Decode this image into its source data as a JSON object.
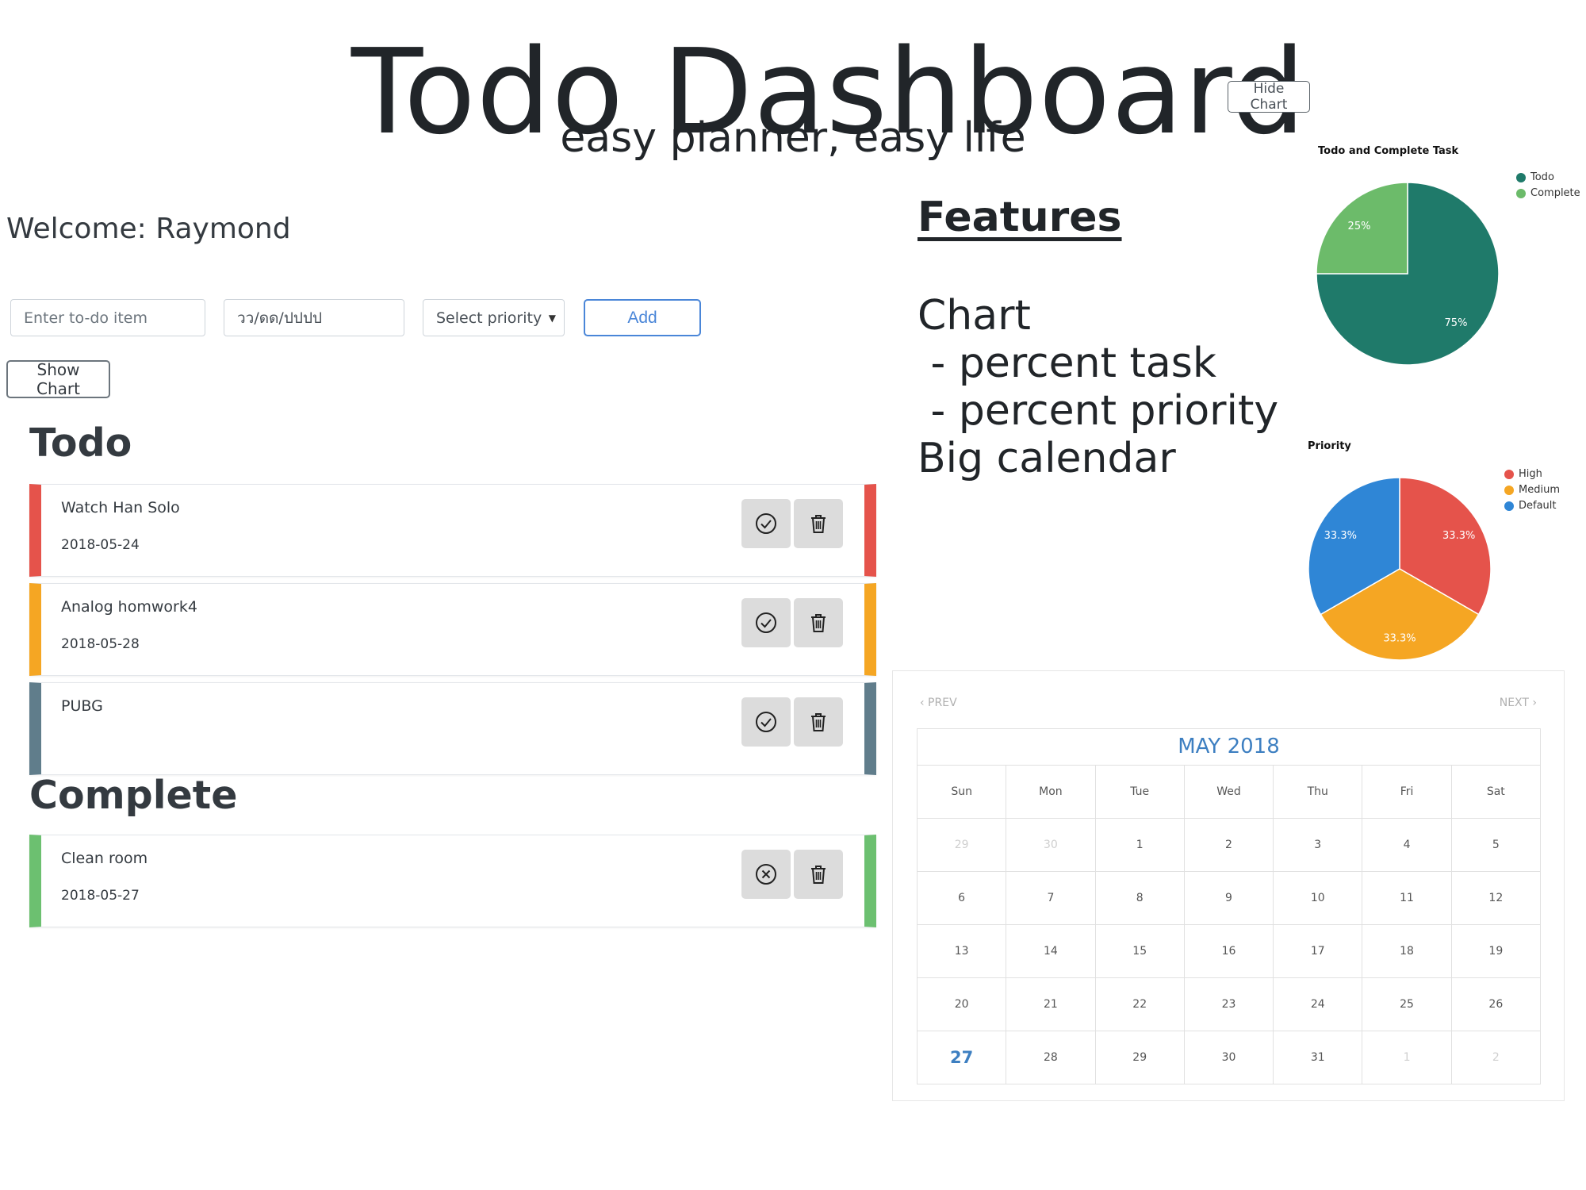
{
  "header": {
    "title": "Todo Dashboard",
    "subtitle": "easy planner, easy life",
    "hide_chart_label": "Hide Chart"
  },
  "welcome": "Welcome: Raymond",
  "form": {
    "todo_placeholder": "Enter to-do item",
    "date_placeholder": "วว/ดด/ปปปป",
    "priority_label": "Select priority",
    "add_label": "Add",
    "show_chart_label": "Show Chart"
  },
  "todo": {
    "title": "Todo",
    "items": [
      {
        "name": "Watch Han Solo",
        "date": "2018-05-24",
        "color": "#e5534b"
      },
      {
        "name": "Analog homwork4",
        "date": "2018-05-28",
        "color": "#f5a623"
      },
      {
        "name": "PUBG",
        "date": "",
        "color": "#607d8b"
      }
    ]
  },
  "complete": {
    "title": "Complete",
    "items": [
      {
        "name": "Clean room",
        "date": "2018-05-27",
        "color": "#6cc070"
      }
    ]
  },
  "features": {
    "title": "Features",
    "lines": [
      "Chart",
      " - percent task",
      " - percent priority",
      "Big calendar"
    ]
  },
  "charts": {
    "task": {
      "title": "Todo and Complete Task",
      "legend": [
        {
          "label": "Todo",
          "color": "#1f7a6a"
        },
        {
          "label": "Complete",
          "color": "#6cbb6a"
        }
      ],
      "slices": [
        {
          "label": "Todo",
          "percent": "75%",
          "value": 75,
          "color": "#1f7a6a"
        },
        {
          "label": "Complete",
          "percent": "25%",
          "value": 25,
          "color": "#6cbb6a"
        }
      ]
    },
    "priority": {
      "title": "Priority",
      "legend": [
        {
          "label": "High",
          "color": "#e5534b"
        },
        {
          "label": "Medium",
          "color": "#f5a623"
        },
        {
          "label": "Default",
          "color": "#2f86d6"
        }
      ],
      "slices": [
        {
          "label": "High",
          "percent": "33.3%",
          "value": 33.3,
          "color": "#e5534b"
        },
        {
          "label": "Medium",
          "percent": "33.3%",
          "value": 33.3,
          "color": "#f5a623"
        },
        {
          "label": "Default",
          "percent": "33.3%",
          "value": 33.3,
          "color": "#2f86d6"
        }
      ]
    }
  },
  "calendar": {
    "prev_label": "‹ PREV",
    "next_label": "NEXT ›",
    "month": "MAY 2018",
    "weekdays": [
      "Sun",
      "Mon",
      "Tue",
      "Wed",
      "Thu",
      "Fri",
      "Sat"
    ],
    "weeks": [
      [
        "29",
        "30",
        "1",
        "2",
        "3",
        "4",
        "5"
      ],
      [
        "6",
        "7",
        "8",
        "9",
        "10",
        "11",
        "12"
      ],
      [
        "13",
        "14",
        "15",
        "16",
        "17",
        "18",
        "19"
      ],
      [
        "20",
        "21",
        "22",
        "23",
        "24",
        "25",
        "26"
      ],
      [
        "27",
        "28",
        "29",
        "30",
        "31",
        "1",
        "2"
      ]
    ],
    "muted": [
      [
        0,
        0
      ],
      [
        0,
        1
      ],
      [
        4,
        5
      ],
      [
        4,
        6
      ]
    ],
    "today": [
      4,
      0
    ]
  }
}
